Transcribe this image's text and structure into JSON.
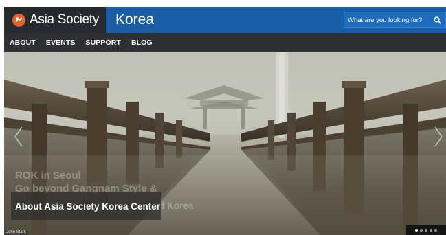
{
  "header": {
    "brand_name": "Asia Society",
    "center_title": "Korea",
    "search_placeholder": "What are you looking for?"
  },
  "nav": {
    "items": [
      "ABOUT",
      "EVENTS",
      "SUPPORT",
      "BLOG"
    ]
  },
  "hero": {
    "ghost_line_1": "ROK in Seoul",
    "ghost_line_2": "Go beyond Gangnam Style &",
    "caption": "About Asia Society Korea Center",
    "caption_trailing": "f Korea",
    "photo_credit": "John Stark",
    "slide_count": 5,
    "active_slide": 1
  },
  "colors": {
    "brand_dark": "#262a2f",
    "brand_blue": "#1a5ea6",
    "nav_bg": "#2e3033",
    "logo_orange": "#e0642a"
  },
  "icons": {
    "logo": "asia-society-logo-icon",
    "search": "search-icon",
    "prev": "chevron-left-icon",
    "next": "chevron-right-icon"
  }
}
